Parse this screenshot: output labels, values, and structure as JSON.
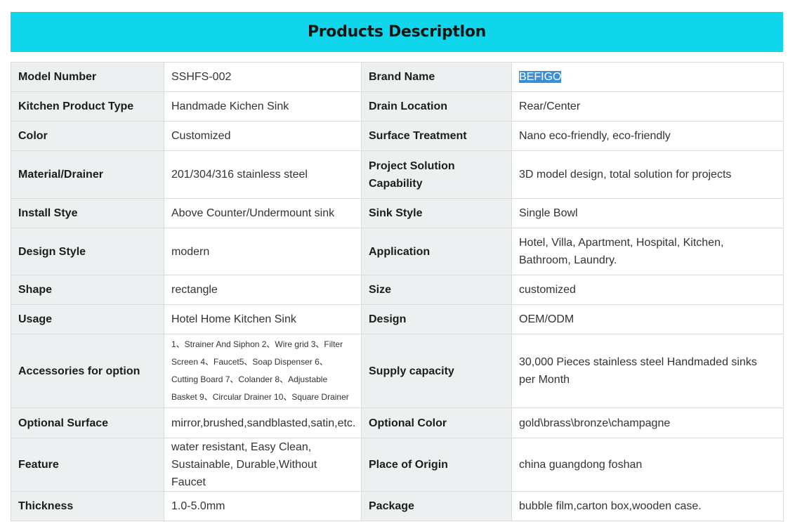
{
  "title": "Products Descriptlon",
  "rows": [
    {
      "k1": "Model Number",
      "v1": "SSHFS-002",
      "k2": "Brand Name",
      "v2": "BEFIGO"
    },
    {
      "k1": "Kitchen Product Type",
      "v1": "Handmade Kichen Sink",
      "k2": "Drain Location",
      "v2": "Rear/Center"
    },
    {
      "k1": "Color",
      "v1": "Customized",
      "k2": "Surface Treatment",
      "v2": "Nano eco-friendly, eco-friendly"
    },
    {
      "k1": "Material/Drainer",
      "v1": "201/304/316 stainless steel",
      "k2": "Project Solution Capability",
      "v2": "3D model design, total solution for projects"
    },
    {
      "k1": "Install Stye",
      "v1": "Above Counter/Undermount sink",
      "k2": "Sink Style",
      "v2": "Single Bowl"
    },
    {
      "k1": "Design Style",
      "v1": "modern",
      "k2": "Application",
      "v2": "Hotel, Villa, Apartment, Hospital, Kitchen, Bathroom, Laundry."
    },
    {
      "k1": "Shape",
      "v1": "rectangle",
      "k2": "Size",
      "v2": "customized"
    },
    {
      "k1": "Usage",
      "v1": "Hotel Home Kitchen Sink",
      "k2": "Design",
      "v2": "OEM/ODM"
    },
    {
      "k1": "Accessories for option",
      "v1": "1、Strainer And Siphon 2、Wire grid 3、Filter Screen 4、Faucet5、Soap Dispenser 6、Cutting Board 7、Colander 8、Adjustable Basket 9、Circular Drainer 10、Square Drainer",
      "k2": "Supply capacity",
      "v2": "30,000 Pieces stainless steel Handmaded sinks per Month"
    },
    {
      "k1": "Optional Surface",
      "v1": "mirror,brushed,sandblasted,satin,etc.",
      "k2": "Optional Color",
      "v2": "gold\\brass\\bronze\\champagne"
    },
    {
      "k1": "Feature",
      "v1": "water resistant, Easy Clean, Sustainable, Durable,Without Faucet",
      "k2": "Place of Origin",
      "v2": "china guangdong foshan"
    },
    {
      "k1": "Thickness",
      "v1": "1.0-5.0mm",
      "k2": "Package",
      "v2": "bubble film,carton box,wooden case."
    }
  ]
}
